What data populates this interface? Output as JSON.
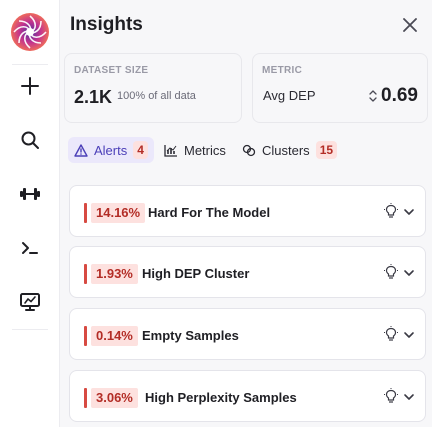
{
  "sidebar": {
    "items": [
      {
        "icon": "plus-icon"
      },
      {
        "icon": "search-icon"
      },
      {
        "icon": "dumbbell-icon"
      },
      {
        "icon": "terminal-icon"
      },
      {
        "icon": "monitor-chart-icon"
      }
    ]
  },
  "header": {
    "title": "Insights",
    "close_icon": "close-icon"
  },
  "dataset": {
    "label": "DATASET SIZE",
    "value": "2.1K",
    "sub": "100% of all data"
  },
  "metric": {
    "label": "METRIC",
    "selected": "Avg DEP",
    "value": "0.69"
  },
  "tabs": [
    {
      "label": "Alerts",
      "count": "4",
      "icon": "warning-icon",
      "active": true
    },
    {
      "label": "Metrics",
      "icon": "bar-chart-icon",
      "active": false
    },
    {
      "label": "Clusters",
      "count": "15",
      "icon": "clusters-icon",
      "active": false
    }
  ],
  "alerts": [
    {
      "percent": "14.16%",
      "name": "Hard For The Model"
    },
    {
      "percent": "1.93%",
      "name": "High DEP Cluster"
    },
    {
      "percent": "0.14%",
      "name": "Empty Samples"
    },
    {
      "percent": "3.06%",
      "name": "High Perplexity Samples"
    }
  ],
  "colors": {
    "accent": "#4b3fb8",
    "alert": "#b32d26",
    "alert_bg": "#fde1df",
    "logo": "#d23f8f"
  }
}
